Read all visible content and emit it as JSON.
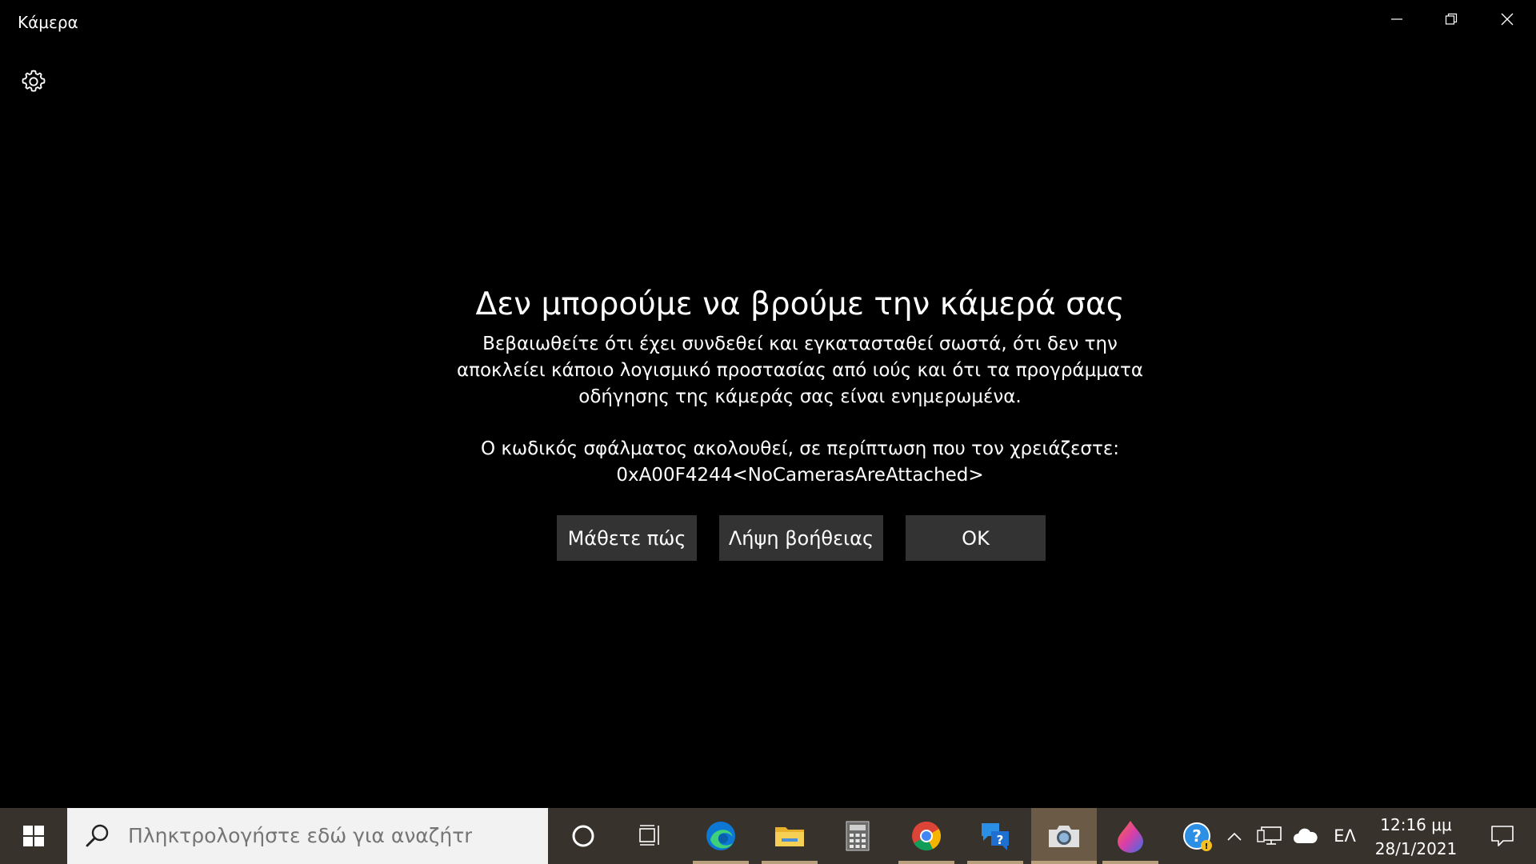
{
  "window": {
    "title": "Κάμερα"
  },
  "error": {
    "title": "Δεν μπορούμε να βρούμε την κάμερά σας",
    "description": "Βεβαιωθείτε ότι έχει συνδεθεί και εγκατασταθεί σωστά, ότι δεν την αποκλείει κάποιο λογισμικό προστασίας από ιούς και ότι τα προγράμματα οδήγησης της κάμεράς σας είναι ενημερωμένα.",
    "code_label": "Ο κωδικός σφάλματος ακολουθεί, σε περίπτωση που τον χρειάζεστε:",
    "code": "0xA00F4244<NoCamerasAreAttached>"
  },
  "buttons": {
    "learn_more": "Μάθετε πώς",
    "get_help": "Λήψη βοήθειας",
    "ok": "OK"
  },
  "taskbar": {
    "search_placeholder": "Πληκτρολογήστε εδώ για αναζήτηση",
    "apps": [
      "cortana-icon",
      "task-view-icon",
      "edge-icon",
      "file-explorer-icon",
      "calculator-icon",
      "chrome-icon",
      "feedback-hub-icon",
      "camera-icon",
      "paint-3d-icon"
    ],
    "tray": {
      "language": "ΕΛ",
      "time": "12:16 μμ",
      "date": "28/1/2021"
    }
  },
  "colors": {
    "background": "#000000",
    "button": "#333333",
    "taskbar": "#38322c",
    "active_app": "#6b5a46"
  }
}
